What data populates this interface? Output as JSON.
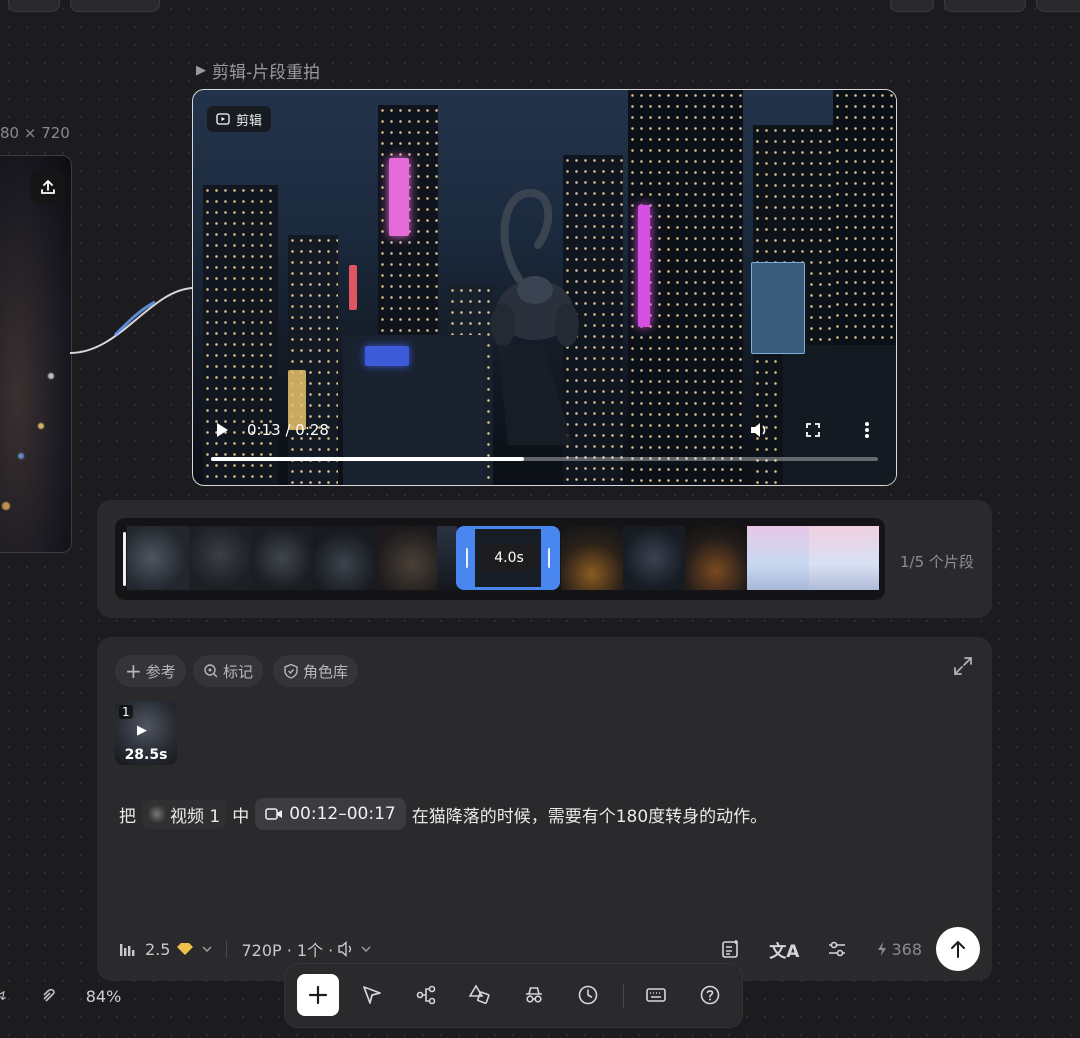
{
  "canvas": {
    "left_card_dimension": "80 × 720",
    "zoom_level": "84%"
  },
  "video_node": {
    "title": "剪辑-片段重拍",
    "tag": "剪辑",
    "current_time": "0:13",
    "duration": "0:28",
    "time_display": "0:13 / 0:28",
    "progress": 0.47
  },
  "timeline": {
    "selected_clip_duration": "4.0s",
    "segment_count_label": "1/5 个片段"
  },
  "composer": {
    "chips": [
      {
        "label": "参考",
        "icon": "plus-icon"
      },
      {
        "label": "标记",
        "icon": "pin-icon"
      },
      {
        "label": "角色库",
        "icon": "shield-icon"
      }
    ],
    "attachment": {
      "index": "1",
      "duration": "28.5s"
    },
    "prompt": {
      "prefix": "把",
      "mention_label": "视频 1",
      "middle": "中",
      "time_range": "00:12–00:17",
      "suffix": "在猫降落的时候，需要有个180度转身的动作。"
    },
    "model_version": "2.5",
    "settings_summary": "720P · 1个 ·",
    "credits": "368"
  },
  "toolbar": {
    "items": [
      "plus-icon",
      "select-arrow-icon",
      "workflow-icon",
      "shapes-icon",
      "incognito-icon",
      "history-icon",
      "keyboard-icon",
      "help-icon"
    ]
  },
  "colors": {
    "background": "#1c1c1e",
    "panel": "#2a2a2c",
    "accent": "#4a86f0",
    "send_button": "#ffffff",
    "badge_gold": "#f0c04a"
  }
}
